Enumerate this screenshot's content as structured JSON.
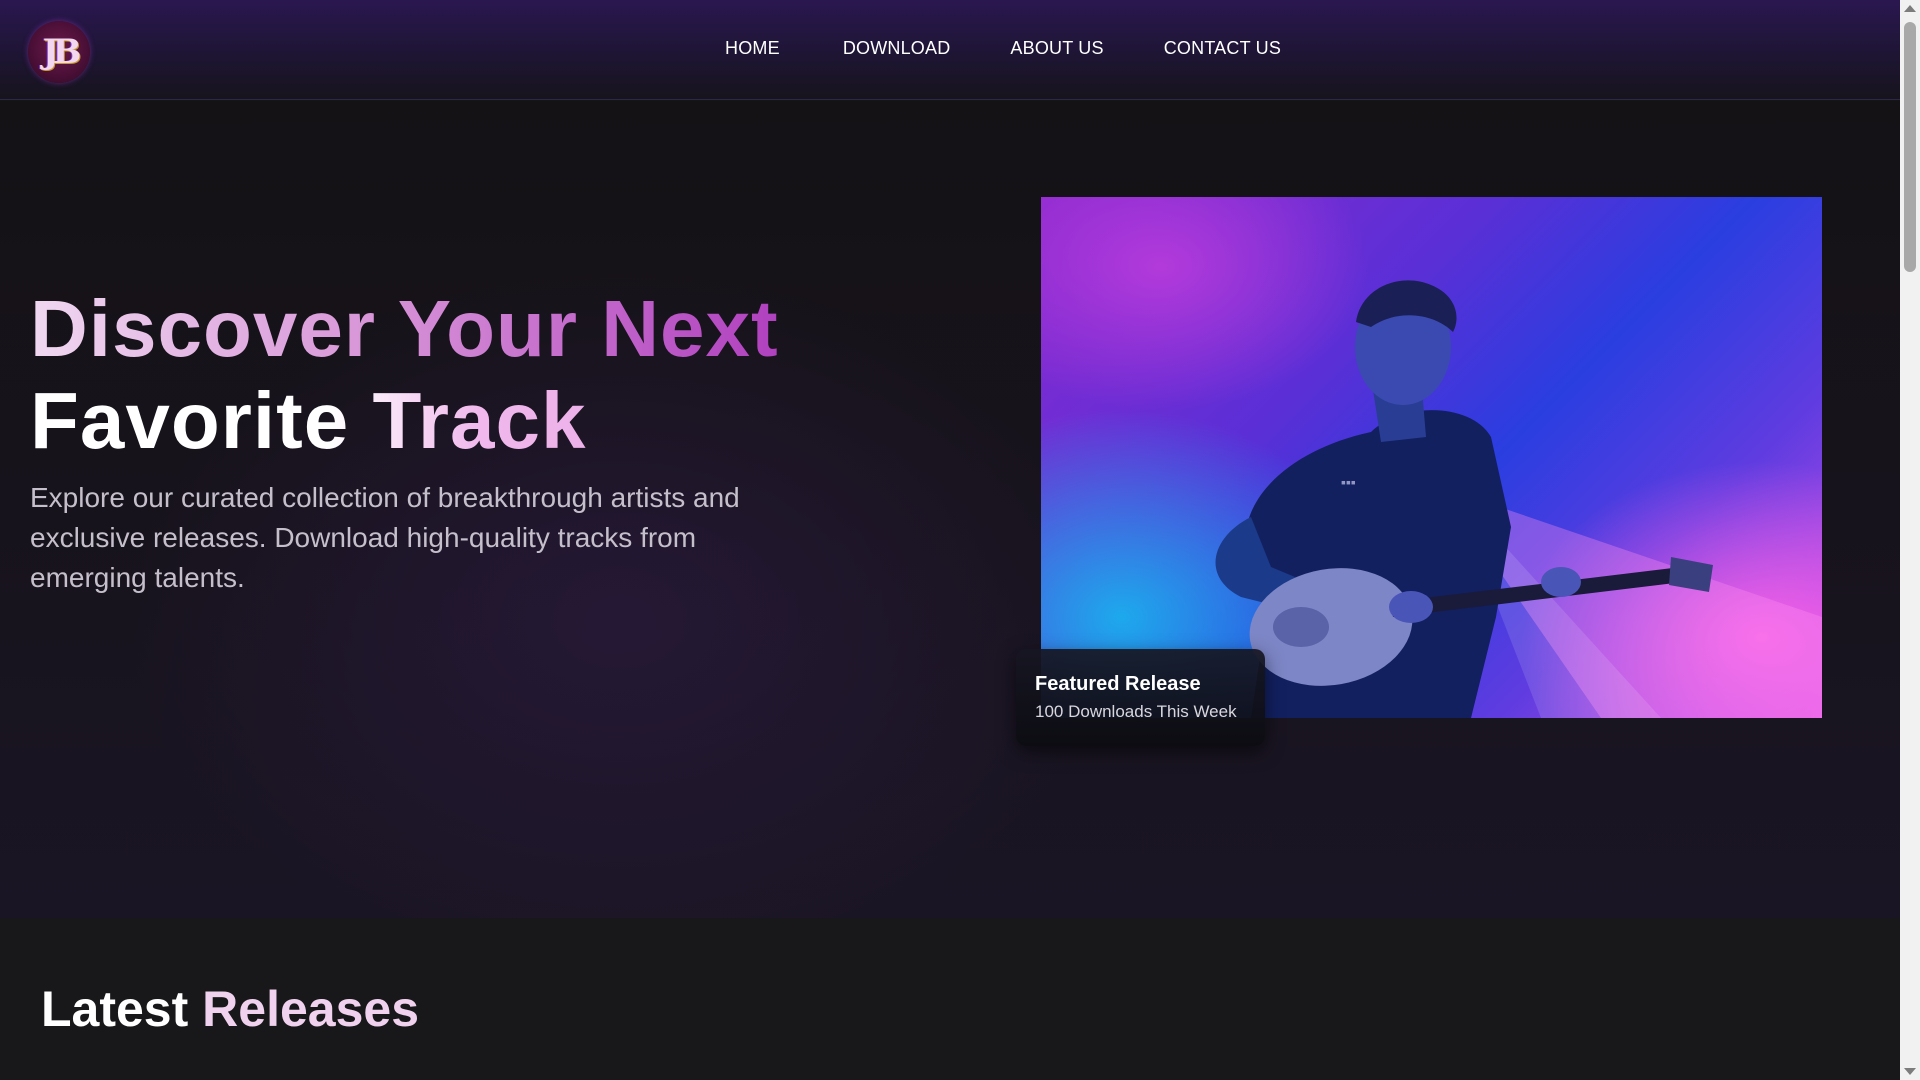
{
  "brand": {
    "logo_text": "JB"
  },
  "nav": {
    "items": [
      {
        "label": "HOME"
      },
      {
        "label": "DOWNLOAD"
      },
      {
        "label": "ABOUT US"
      },
      {
        "label": "CONTACT US"
      }
    ]
  },
  "hero": {
    "title_line1": "Discover Your Next",
    "title_line2": "Favorite Track",
    "description": "Explore our curated collection of breakthrough artists and exclusive releases. Download high-quality tracks from emerging talents.",
    "featured": {
      "title": "Featured Release",
      "subtitle": "100 Downloads This Week"
    }
  },
  "releases": {
    "title_word1": "Latest",
    "title_word2": "Releases"
  },
  "colors": {
    "accent": "#b040bf",
    "nav_bg": "#2a1750",
    "page_bg": "#151417"
  }
}
